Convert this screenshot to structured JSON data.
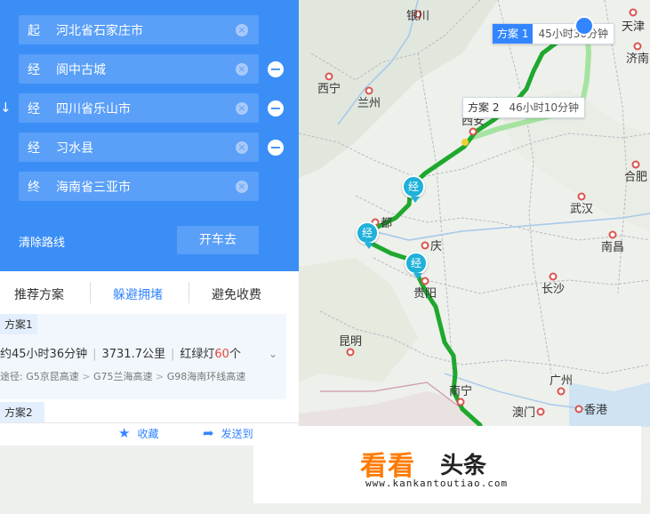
{
  "map": {
    "cities": [
      {
        "id": "yinchuan",
        "label": "银川"
      },
      {
        "id": "xining",
        "label": "西宁"
      },
      {
        "id": "lanzhou",
        "label": "兰州"
      },
      {
        "id": "xian",
        "label": "西安"
      },
      {
        "id": "tianjin",
        "label": "天津"
      },
      {
        "id": "jinan",
        "label": "济南"
      },
      {
        "id": "hefei",
        "label": "合肥"
      },
      {
        "id": "wuhan",
        "label": "武汉"
      },
      {
        "id": "nanchang",
        "label": "南昌"
      },
      {
        "id": "changsha",
        "label": "长沙"
      },
      {
        "id": "chengdu",
        "label": "都"
      },
      {
        "id": "chongqing",
        "label": "庆"
      },
      {
        "id": "guiyang",
        "label": "贵阳"
      },
      {
        "id": "kunming",
        "label": "昆明"
      },
      {
        "id": "nanning",
        "label": "南宁"
      },
      {
        "id": "guangzhou",
        "label": "广州"
      },
      {
        "id": "aomen",
        "label": "澳门"
      },
      {
        "id": "xianggang",
        "label": "香港"
      }
    ],
    "route_tags": [
      {
        "name": "方案 1",
        "time": "45小时36分钟",
        "active": true
      },
      {
        "name": "方案 2",
        "time": "46小时10分钟",
        "active": false
      }
    ],
    "waypoint_pin_label": "经",
    "colors": {
      "route_primary": "#1fa82e",
      "route_secondary": "#a5e3a0",
      "panel_blue": "#3b8ef6",
      "accent": "#3385ff"
    }
  },
  "panel": {
    "waypoints": [
      {
        "type": "起",
        "name": "河北省石家庄市",
        "removable": false
      },
      {
        "type": "经",
        "name": "阆中古城",
        "removable": true
      },
      {
        "type": "经",
        "name": "四川省乐山市",
        "removable": true
      },
      {
        "type": "经",
        "name": "习水县",
        "removable": true
      },
      {
        "type": "终",
        "name": "海南省三亚市",
        "removable": false
      }
    ],
    "clear_route": "清除路线",
    "start_drive": "开车去",
    "swap_icon": "↓",
    "clear_icon": "×",
    "remove_icon": "−",
    "tabs": [
      {
        "label": "推荐方案",
        "active": false
      },
      {
        "label": "躲避拥堵",
        "active": true
      },
      {
        "label": "避免收费",
        "active": false
      }
    ],
    "plan1": {
      "label": "方案1",
      "duration": "约45小时36分钟",
      "distance": "3731.7公里",
      "lights_prefix": "红绿灯",
      "lights_count": "60",
      "lights_suffix": "个",
      "via_prefix": "途径:",
      "via": [
        "G5京昆高速",
        "G75兰海高速",
        "G98海南环线高速"
      ],
      "expand_icon": "chevron-down-icon"
    },
    "plan2": {
      "label": "方案2"
    },
    "actions": [
      {
        "label": "收藏",
        "icon": "star-icon"
      },
      {
        "label": "发送到",
        "icon": "send-icon"
      }
    ]
  },
  "watermark": {
    "brand_a": "看看",
    "brand_b": "头条",
    "url": "www.kankantoutiao.com"
  }
}
